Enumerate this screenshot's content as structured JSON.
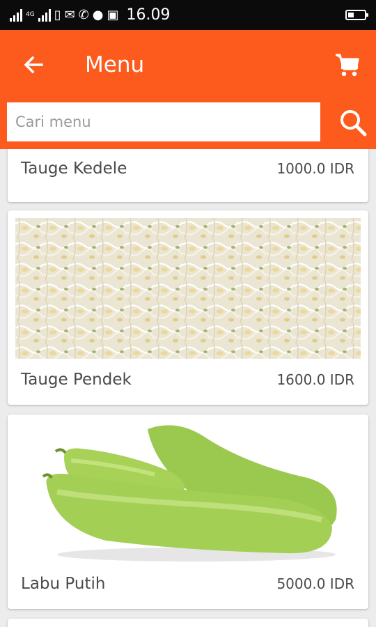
{
  "status_bar": {
    "network_label": "4G",
    "time": "16.09",
    "battery_level": 0.35
  },
  "app_bar": {
    "title": "Menu",
    "back_icon": "arrow-left-icon",
    "cart_icon": "shopping-cart-icon",
    "accent_color": "#fd5a1e"
  },
  "search": {
    "placeholder": "Cari menu",
    "value": "",
    "icon": "search-icon"
  },
  "menu_items": [
    {
      "name": "Tauge Kedele",
      "price": "1000.0 IDR"
    },
    {
      "name": "Tauge Pendek",
      "price": "1600.0 IDR"
    },
    {
      "name": "Labu Putih",
      "price": "5000.0 IDR"
    }
  ]
}
